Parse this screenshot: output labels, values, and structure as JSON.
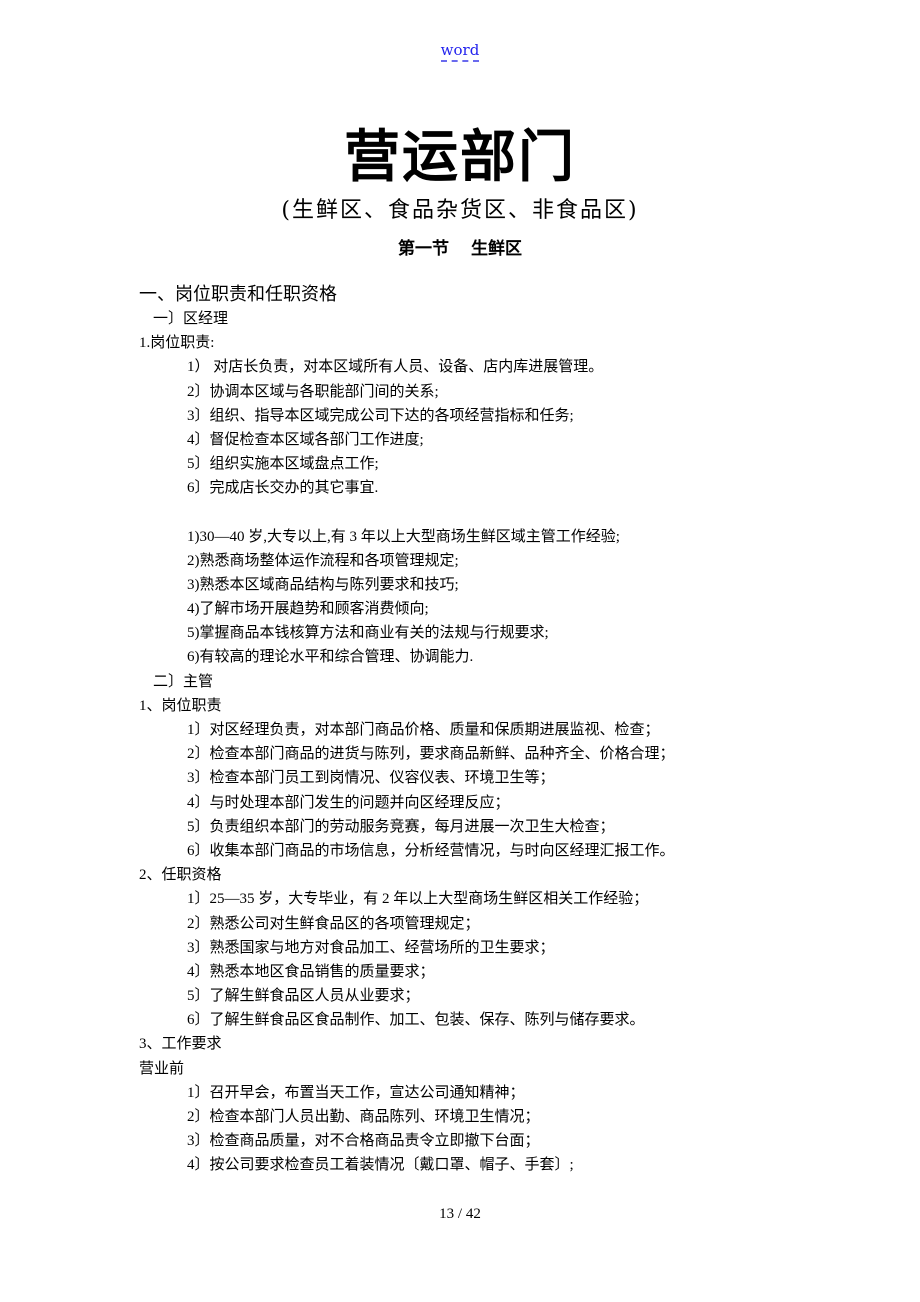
{
  "header": {
    "link_label": "word",
    "link_color": "#2222ee"
  },
  "title": "营运部门",
  "subtitle": "(生鲜区、食品杂货区、非食品区)",
  "section": {
    "number": "第一节",
    "name": "生鲜区"
  },
  "lines": [
    {
      "style": "h1",
      "text": "一、岗位职责和任职资格"
    },
    {
      "style": "ind1",
      "text": "一〕区经理"
    },
    {
      "style": "",
      "text": "1.岗位职责:"
    },
    {
      "style": "ind2",
      "text": "1） 对店长负责，对本区域所有人员、设备、店内库进展管理。"
    },
    {
      "style": "ind2",
      "text": "2〕协调本区域与各职能部门间的关系;"
    },
    {
      "style": "ind2",
      "text": "3〕组织、指导本区域完成公司下达的各项经营指标和任务;"
    },
    {
      "style": "ind2",
      "text": "4〕督促检查本区域各部门工作进度;"
    },
    {
      "style": "ind2",
      "text": "5〕组织实施本区域盘点工作;"
    },
    {
      "style": "ind2",
      "text": "6〕完成店长交办的其它事宜."
    },
    {
      "style": "blank",
      "text": ""
    },
    {
      "style": "ind2",
      "text": "1)30—40 岁,大专以上,有 3 年以上大型商场生鲜区域主管工作经验;"
    },
    {
      "style": "ind2",
      "text": "2)熟悉商场整体运作流程和各项管理规定;"
    },
    {
      "style": "ind2",
      "text": "3)熟悉本区域商品结构与陈列要求和技巧;"
    },
    {
      "style": "ind2",
      "text": "4)了解市场开展趋势和顾客消费倾向;"
    },
    {
      "style": "ind2",
      "text": "5)掌握商品本钱核算方法和商业有关的法规与行规要求;"
    },
    {
      "style": "ind2",
      "text": "6)有较高的理论水平和综合管理、协调能力."
    },
    {
      "style": "ind1",
      "text": "二〕主管"
    },
    {
      "style": "",
      "text": "1、岗位职责"
    },
    {
      "style": "ind2",
      "text": "1〕对区经理负责，对本部门商品价格、质量和保质期进展监视、检查；"
    },
    {
      "style": "ind2",
      "text": "2〕检查本部门商品的进货与陈列，要求商品新鲜、品种齐全、价格合理；"
    },
    {
      "style": "ind2",
      "text": "3〕检查本部门员工到岗情况、仪容仪表、环境卫生等；"
    },
    {
      "style": "ind2",
      "text": "4〕与时处理本部门发生的问题并向区经理反应；"
    },
    {
      "style": "ind2",
      "text": "5〕负责组织本部门的劳动服务竞赛，每月进展一次卫生大检查；"
    },
    {
      "style": "ind2",
      "text": "6〕收集本部门商品的市场信息，分析经营情况，与时向区经理汇报工作。"
    },
    {
      "style": "",
      "text": "2、任职资格"
    },
    {
      "style": "ind2",
      "text": "1〕25—35 岁，大专毕业，有 2 年以上大型商场生鲜区相关工作经验；"
    },
    {
      "style": "ind2",
      "text": "2〕熟悉公司对生鲜食品区的各项管理规定；"
    },
    {
      "style": "ind2",
      "text": "3〕熟悉国家与地方对食品加工、经营场所的卫生要求；"
    },
    {
      "style": "ind2",
      "text": "4〕熟悉本地区食品销售的质量要求；"
    },
    {
      "style": "ind2",
      "text": "5〕了解生鲜食品区人员从业要求；"
    },
    {
      "style": "ind2",
      "text": "6〕了解生鲜食品区食品制作、加工、包装、保存、陈列与储存要求。"
    },
    {
      "style": "",
      "text": "3、工作要求"
    },
    {
      "style": "",
      "text": "营业前"
    },
    {
      "style": "ind2",
      "text": "1〕召开早会，布置当天工作，宣达公司通知精神；"
    },
    {
      "style": "ind2",
      "text": "2〕检查本部门人员出勤、商品陈列、环境卫生情况；"
    },
    {
      "style": "ind2",
      "text": "3〕检查商品质量，对不合格商品责令立即撤下台面；"
    },
    {
      "style": "ind2",
      "text": "4〕按公司要求检查员工着装情况〔戴口罩、帽子、手套〕;"
    }
  ],
  "footer": {
    "page_current": "13",
    "page_total": "42",
    "page_label": "13  / 42"
  }
}
